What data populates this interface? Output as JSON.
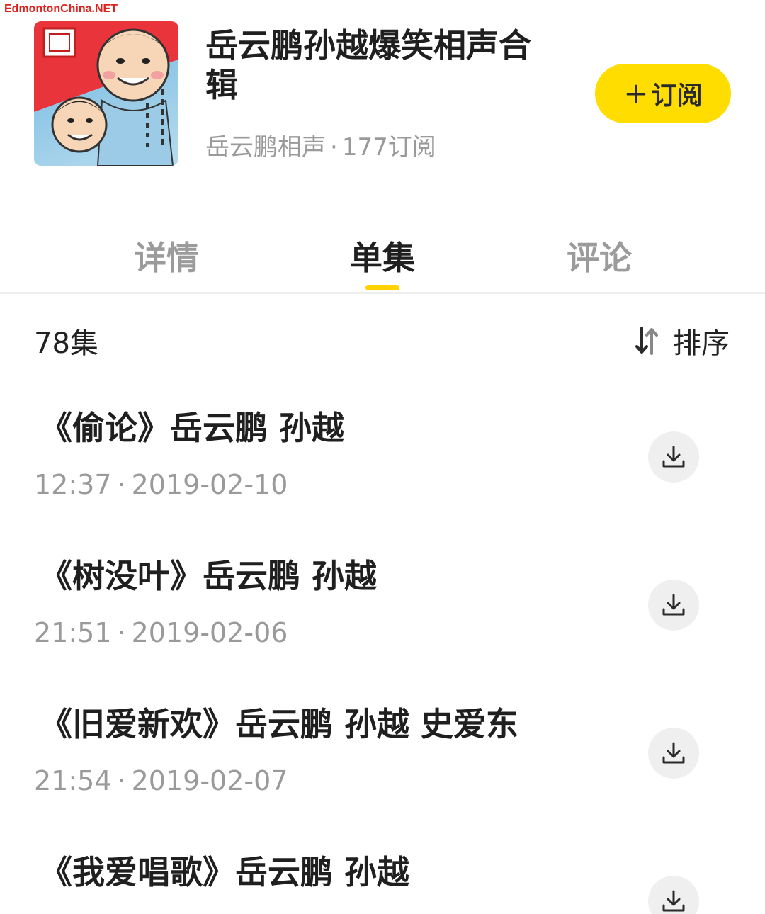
{
  "watermark": "EdmontonChina.NET",
  "album": {
    "title": "岳云鹏孙越爆笑相声合辑",
    "author": "岳云鹏相声",
    "separator": "·",
    "subscribers": "177订阅",
    "cover_icon": "cartoon-comedians-cover"
  },
  "subscribe": {
    "plus": "+",
    "label": "订阅"
  },
  "tabs": [
    {
      "label": "详情",
      "active": false
    },
    {
      "label": "单集",
      "active": true
    },
    {
      "label": "评论",
      "active": false
    }
  ],
  "list": {
    "count": "78集",
    "sort_label": "排序",
    "sort_icon": "sort-arrows-icon"
  },
  "episodes": [
    {
      "title": "《偷论》岳云鹏 孙越",
      "duration": "12:37",
      "separator": "·",
      "date": "2019-02-10"
    },
    {
      "title": "《树没叶》岳云鹏 孙越",
      "duration": "21:51",
      "separator": "·",
      "date": "2019-02-06"
    },
    {
      "title": "《旧爱新欢》岳云鹏 孙越 史爱东",
      "duration": "21:54",
      "separator": "·",
      "date": "2019-02-07"
    },
    {
      "title": "《我爱唱歌》岳云鹏 孙越",
      "duration": "",
      "separator": "",
      "date": ""
    }
  ],
  "colors": {
    "accent": "#ffdd00",
    "indicator": "#ffd200",
    "muted_text": "#9a9a9a",
    "watermark": "#e0201a"
  }
}
